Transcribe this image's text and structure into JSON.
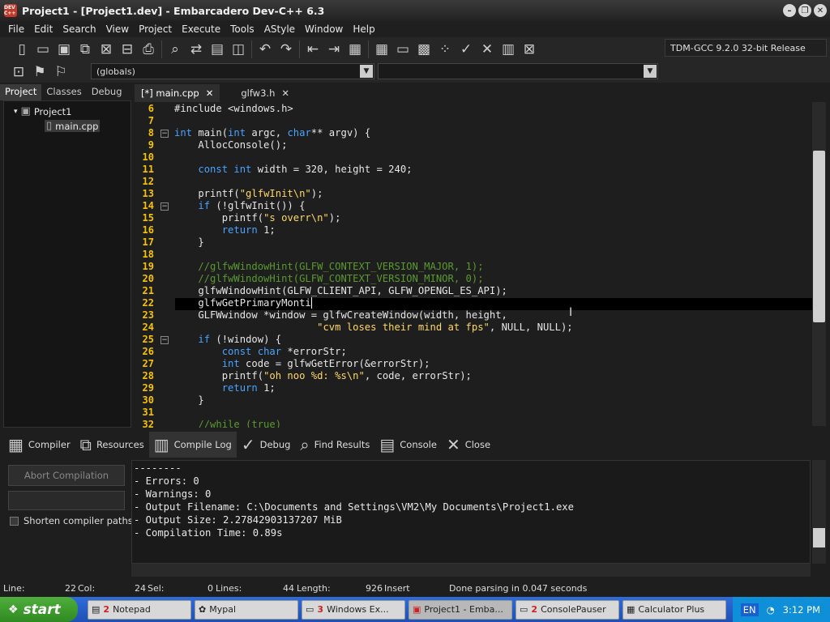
{
  "window": {
    "title": "Project1 - [Project1.dev] - Embarcadero Dev-C++ 6.3",
    "app_icon_text": "DEV C++"
  },
  "menu": [
    "File",
    "Edit",
    "Search",
    "View",
    "Project",
    "Execute",
    "Tools",
    "AStyle",
    "Window",
    "Help"
  ],
  "compiler_select": "TDM-GCC 9.2.0 32-bit Release",
  "scope_select": "(globals)",
  "left_tabs": [
    "Project",
    "Classes",
    "Debug"
  ],
  "tree": {
    "project": "Project1",
    "file": "main.cpp"
  },
  "editor_tabs": [
    {
      "label": "[*] main.cpp"
    },
    {
      "label": "glfw3.h"
    }
  ],
  "line_numbers": [
    "6",
    "7",
    "8",
    "9",
    "10",
    "11",
    "12",
    "13",
    "14",
    "15",
    "16",
    "17",
    "18",
    "19",
    "20",
    "21",
    "22",
    "23",
    "24",
    "25",
    "26",
    "27",
    "28",
    "29",
    "30",
    "31",
    "32"
  ],
  "code": {
    "l6": "#include <windows.h>",
    "l8a": "int",
    "l8b": " main(",
    "l8c": "int",
    "l8d": " argc, ",
    "l8e": "char",
    "l8f": "** argv) {",
    "l9": "    AllocConsole();",
    "l11a": "    ",
    "l11b": "const int",
    "l11c": " width = 320, height = 240;",
    "l13a": "    printf(",
    "l13b": "\"glfwInit\\n\"",
    "l13c": ");",
    "l14a": "    ",
    "l14b": "if",
    "l14c": " (!glfwInit()) {",
    "l15a": "        printf(",
    "l15b": "\"s overr\\n\"",
    "l15c": ");",
    "l16a": "        ",
    "l16b": "return",
    "l16c": " 1;",
    "l17": "    }",
    "l19": "    //glfwWindowHint(GLFW_CONTEXT_VERSION_MAJOR, 1);",
    "l20": "    //glfwWindowHint(GLFW_CONTEXT_VERSION_MINOR, 0);",
    "l21": "    glfwWindowHint(GLFW_CLIENT_API, GLFW_OPENGL_ES_API);",
    "l22": "    glfwGetPrimaryMonti",
    "l23": "    GLFWwindow *window = glfwCreateWindow(width, height,",
    "l24a": "                        ",
    "l24b": "\"cvm loses their mind at fps\"",
    "l24c": ", NULL, NULL);",
    "l25a": "    ",
    "l25b": "if",
    "l25c": " (!window) {",
    "l26a": "        ",
    "l26b": "const char",
    "l26c": " *errorStr;",
    "l27a": "        ",
    "l27b": "int",
    "l27c": " code = glfwGetError(&errorStr);",
    "l28a": "        printf(",
    "l28b": "\"oh noo %d: %s\\n\"",
    "l28c": ", code, errorStr);",
    "l29a": "        ",
    "l29b": "return",
    "l29c": " 1;",
    "l30": "    }",
    "l32": "    //while (true)"
  },
  "bottom_tabs": [
    "Compiler",
    "Resources",
    "Compile Log",
    "Debug",
    "Find Results",
    "Console",
    "Close"
  ],
  "abort_label": "Abort Compilation",
  "shorten_label": "Shorten compiler paths",
  "output_lines": [
    "--------",
    "- Errors: 0",
    "- Warnings: 0",
    "- Output Filename: C:\\Documents and Settings\\VM2\\My Documents\\Project1.exe",
    "- Output Size: 2.27842903137207 MiB",
    "- Compilation Time: 0.89s"
  ],
  "status": {
    "line_label": "Line:",
    "line": "22",
    "col_label": "Col:",
    "col": "24",
    "sel_label": "Sel:",
    "sel": "0",
    "lines_label": "Lines:",
    "lines": "44",
    "length_label": "Length:",
    "length": "926",
    "mode": "Insert",
    "message": "Done parsing in 0.047 seconds"
  },
  "taskbar": {
    "start": "start",
    "items": [
      {
        "num": "2",
        "label": "Notepad"
      },
      {
        "num": "",
        "label": "Mypal"
      },
      {
        "num": "3",
        "label": "Windows Ex..."
      },
      {
        "num": "",
        "label": "Project1 - Emba..."
      },
      {
        "num": "2",
        "label": "ConsolePauser"
      },
      {
        "num": "",
        "label": "Calculator Plus"
      }
    ],
    "lang": "EN",
    "clock": "3:12 PM"
  }
}
